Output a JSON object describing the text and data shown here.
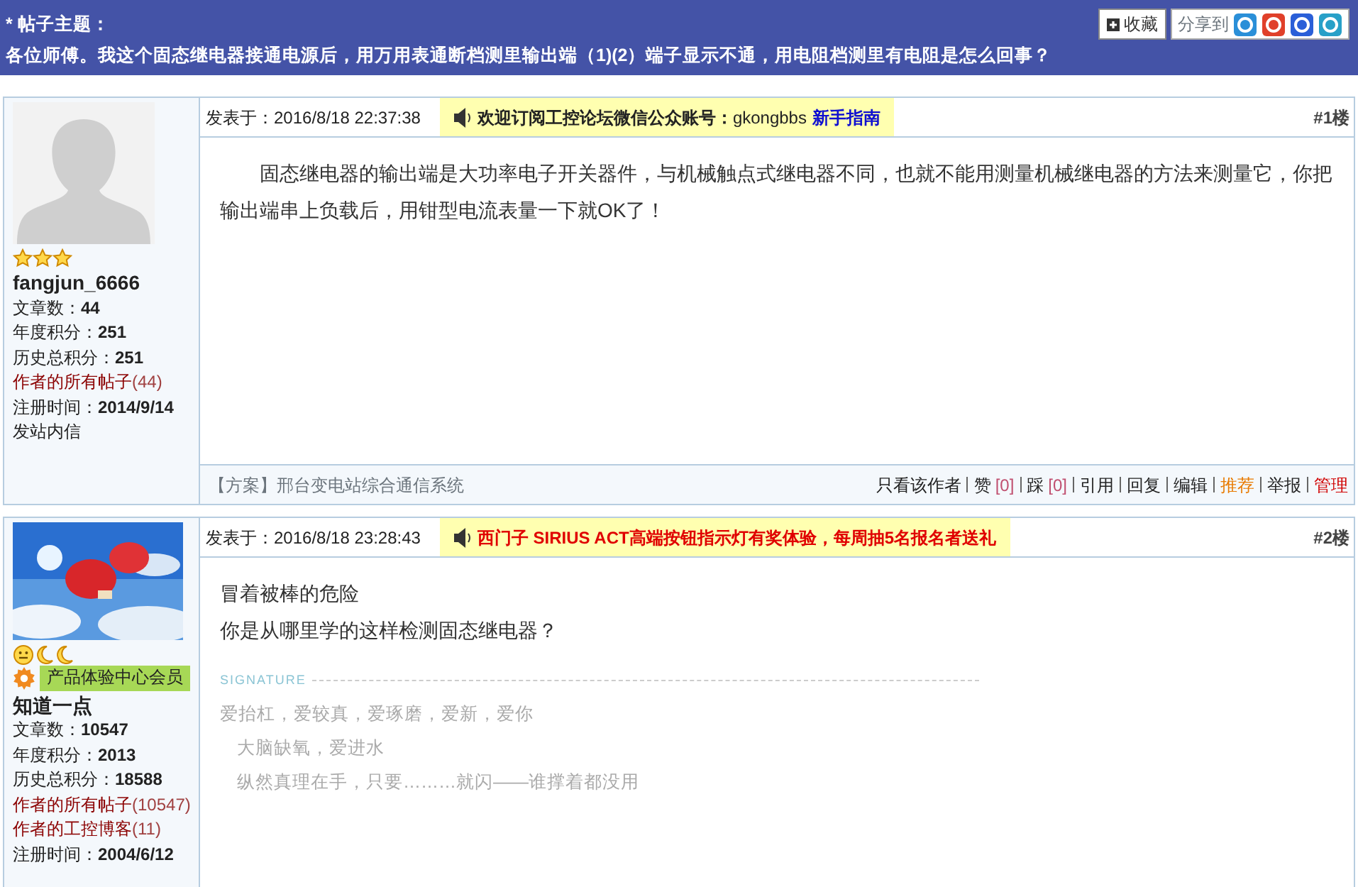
{
  "topic": {
    "label": "* 帖子主题：",
    "title": "各位师傅。我这个固态继电器接通电源后，用万用表通断档测里输出端（1)(2）端子显示不通，用电阻档测里有电阻是怎么回事？"
  },
  "toolbar": {
    "favorite": "收藏",
    "share_label": "分享到",
    "share_icons": [
      {
        "color": "#2a8fd8"
      },
      {
        "color": "#e0402a"
      },
      {
        "color": "#2a5fd8"
      },
      {
        "color": "#28a0c8"
      }
    ]
  },
  "posts": [
    {
      "avatar": {
        "kind": "silhouette"
      },
      "rank_icons": [
        {
          "kind": "star"
        },
        {
          "kind": "star"
        },
        {
          "kind": "star"
        }
      ],
      "username": "fangjun_6666",
      "stats": [
        {
          "label": "文章数：",
          "value": "44"
        },
        {
          "label": "年度积分：",
          "value": "251"
        },
        {
          "label": "历史总积分：",
          "value": "251"
        }
      ],
      "links": [
        {
          "label": "作者的所有帖子",
          "count": "(44)"
        }
      ],
      "registered": {
        "label": "注册时间：",
        "value": "2014/9/14"
      },
      "message_link": "发站内信",
      "posted": "发表于：2016/8/18 22:37:38",
      "notice": [
        {
          "kind": "bold",
          "text": "欢迎订阅工控论坛微信公众账号："
        },
        {
          "kind": "plain",
          "text": "gkongbbs"
        },
        {
          "kind": "link",
          "text": "新手指南"
        }
      ],
      "floor": "#1楼",
      "body": [
        "固态继电器的输出端是大功率电子开关器件，与机械触点式继电器不同，也就不能用测量机械继电器的方法来测量它，你把输出端串上负载后，用钳型电流表量一下就OK了！"
      ],
      "indent": true,
      "footer_link": "【方案】邢台变电站综合通信系统",
      "actions": [
        {
          "kind": "plain",
          "text": "只看该作者"
        },
        {
          "kind": "vote",
          "text": "赞",
          "count": "[0]"
        },
        {
          "kind": "vote",
          "text": "踩",
          "count": "[0]"
        },
        {
          "kind": "plain",
          "text": "引用"
        },
        {
          "kind": "plain",
          "text": "回复"
        },
        {
          "kind": "plain",
          "text": "编辑"
        },
        {
          "kind": "orange",
          "text": "推荐"
        },
        {
          "kind": "plain",
          "text": "举报"
        },
        {
          "kind": "red",
          "text": "管理"
        }
      ]
    },
    {
      "avatar": {
        "kind": "picture"
      },
      "rank_icons": [
        {
          "kind": "smiley"
        },
        {
          "kind": "moon"
        },
        {
          "kind": "moon"
        }
      ],
      "badge": "产品体验中心会员",
      "username": "知道一点",
      "stats": [
        {
          "label": "文章数：",
          "value": "10547"
        },
        {
          "label": "年度积分：",
          "value": "2013"
        },
        {
          "label": "历史总积分：",
          "value": "18588"
        }
      ],
      "links": [
        {
          "label": "作者的所有帖子",
          "count": "(10547)"
        },
        {
          "label": "作者的工控博客",
          "count": "(11)"
        }
      ],
      "registered": {
        "label": "注册时间：",
        "value": "2004/6/12"
      },
      "posted": "发表于：2016/8/18 23:28:43",
      "notice": [
        {
          "kind": "alert",
          "text": "西门子 SIRIUS ACT高端按钮指示灯有奖体验，每周抽5名报名者送礼"
        }
      ],
      "floor": "#2楼",
      "body": [
        "冒着被棒的危险",
        "你是从哪里学的这样检测固态继电器？"
      ],
      "indent": false,
      "signature": {
        "label": "SIGNATURE",
        "lines": [
          {
            "text": "爱抬杠，爱较真，爱琢磨，爱新，爱你",
            "indent": false
          },
          {
            "text": "大脑缺氧，爱进水",
            "indent": true
          },
          {
            "text": "纵然真理在手，只要………就闪——谁撑着都没用",
            "indent": true
          }
        ]
      }
    }
  ]
}
